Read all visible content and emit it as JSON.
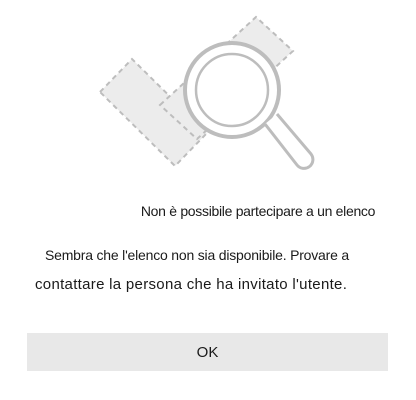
{
  "dialog": {
    "illustration_icon": "magnifying-glass-over-list-icon",
    "title": "Non è possibile partecipare a un elenco",
    "message_line1": "Sembra che l'elenco non sia disponibile. Provare a",
    "message_line2": "contattare la persona che ha invitato l'utente.",
    "ok_label": "OK"
  },
  "colors": {
    "background": "#ffffff",
    "illustration_stroke": "#bdbdbd",
    "illustration_fill": "#ececec",
    "button_bg": "#e8e8e8",
    "text": "#1a1a1a"
  }
}
